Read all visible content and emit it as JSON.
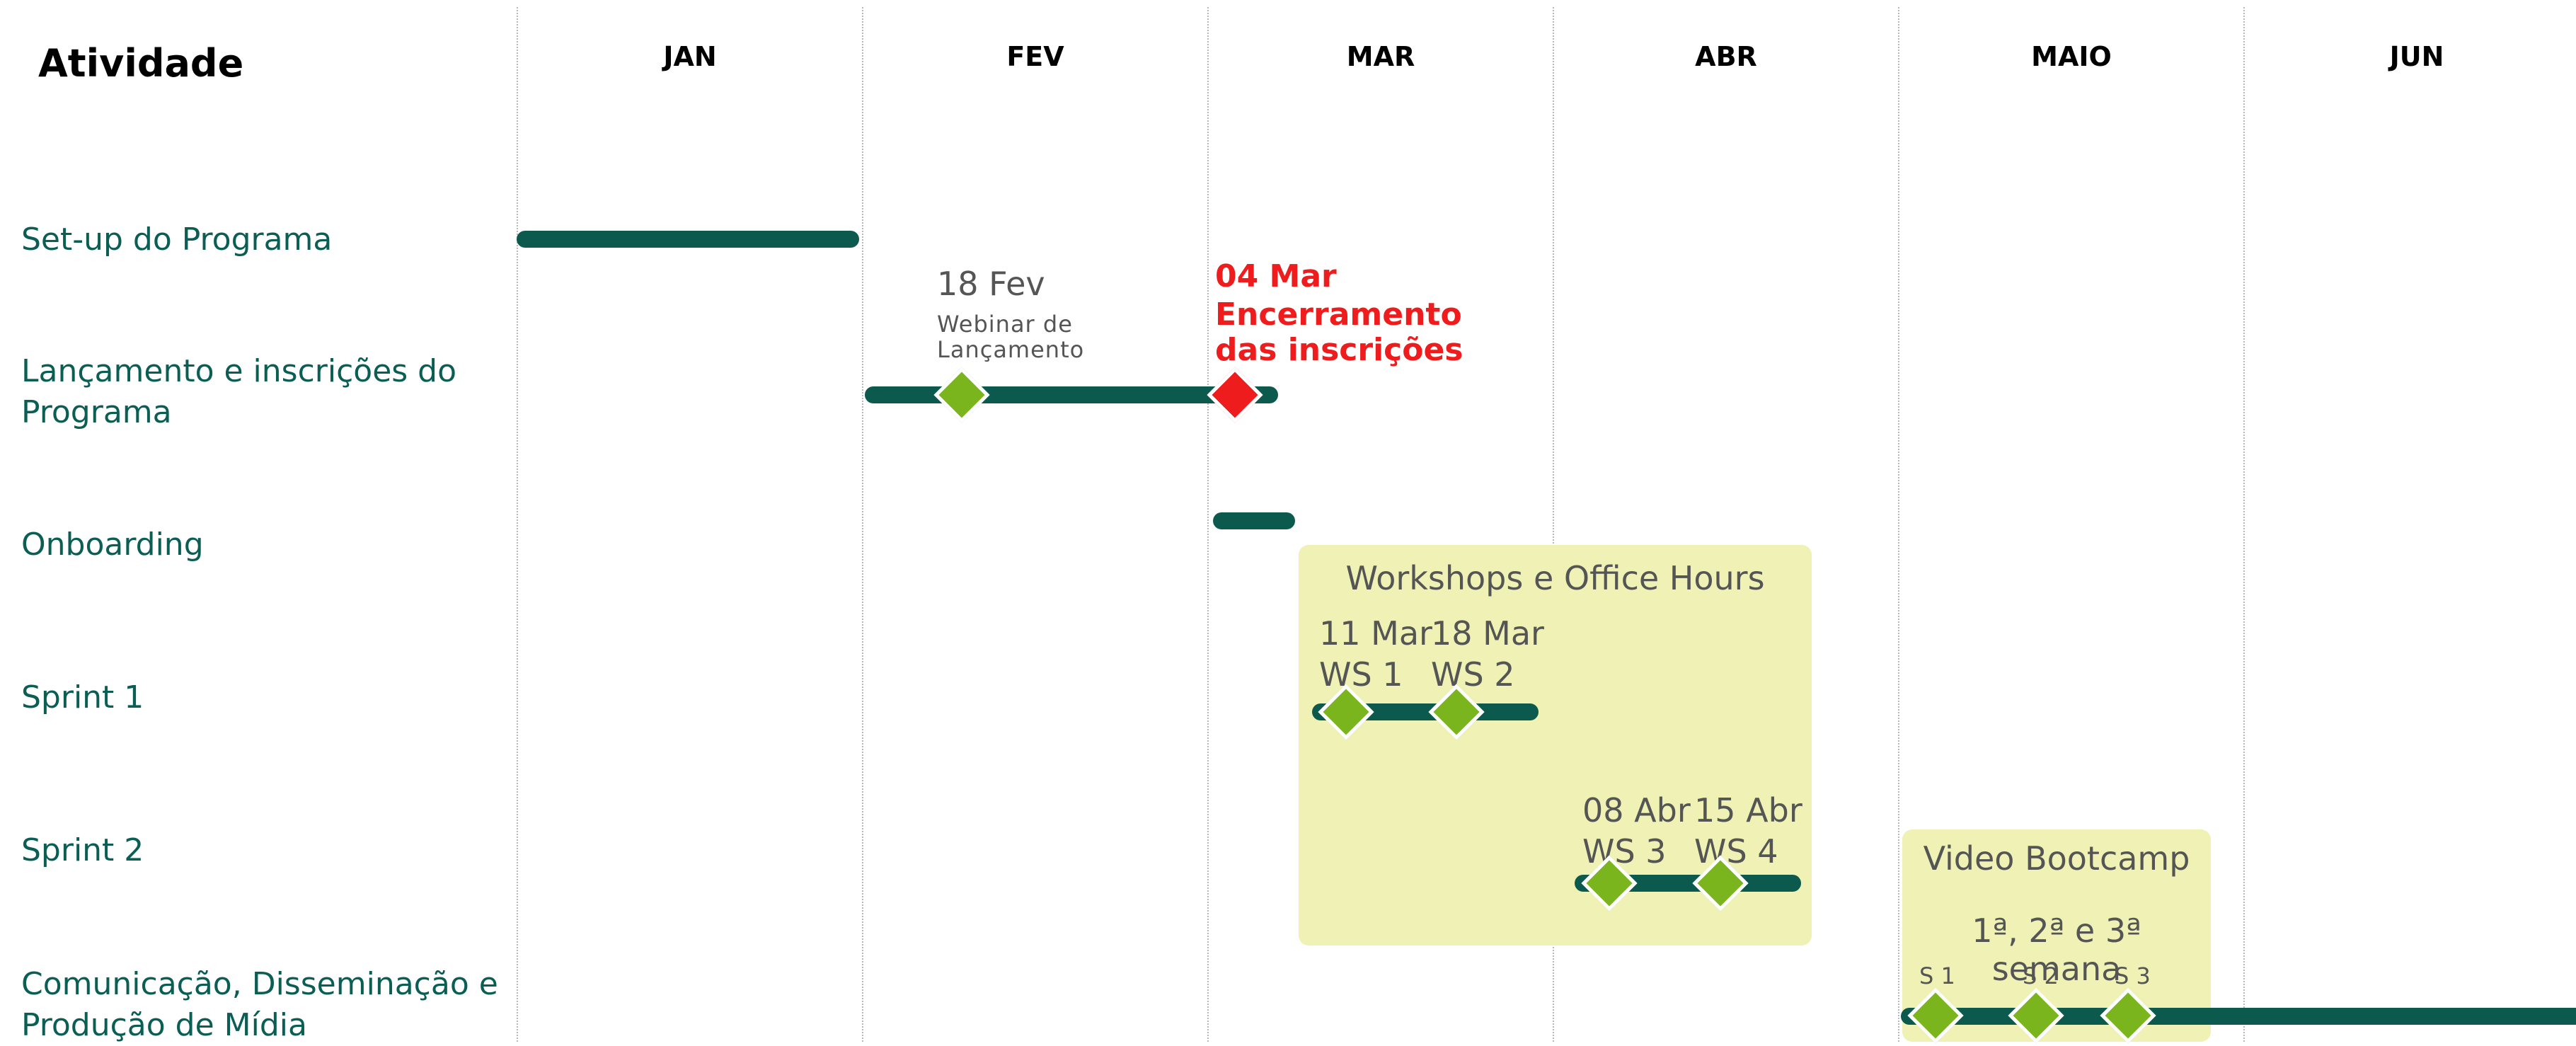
{
  "header": {
    "activity_label": "Atividade"
  },
  "months": [
    "JAN",
    "FEV",
    "MAR",
    "ABR",
    "MAIO",
    "JUN"
  ],
  "rows": [
    {
      "label_lines": [
        "Set-up do Programa"
      ]
    },
    {
      "label_lines": [
        "Lançamento e inscrições do",
        "Programa"
      ]
    },
    {
      "label_lines": [
        "Onboarding"
      ]
    },
    {
      "label_lines": [
        "Sprint 1"
      ]
    },
    {
      "label_lines": [
        "Sprint 2"
      ]
    },
    {
      "label_lines": [
        "Comunicação, Disseminação e",
        "Produção de Mídia"
      ]
    }
  ],
  "milestones": {
    "webinar": {
      "date": "18 Fev",
      "desc_line1": "Webinar de",
      "desc_line2": "Lançamento"
    },
    "closing": {
      "date": "04 Mar",
      "desc_line1": "Encerramento",
      "desc_line2": "das inscrições"
    },
    "ws1": {
      "date": "11 Mar",
      "label": "WS 1"
    },
    "ws2": {
      "date": "18 Mar",
      "label": "WS 2"
    },
    "ws3": {
      "date": "08 Abr",
      "label": "WS 3"
    },
    "ws4": {
      "date": "15 Abr",
      "label": "WS 4"
    },
    "s1": {
      "label": "S 1"
    },
    "s2": {
      "label": "S 2"
    },
    "s3": {
      "label": "S 3"
    }
  },
  "boxes": {
    "workshops": {
      "title": "Workshops e Office Hours"
    },
    "bootcamp": {
      "title": "Video Bootcamp",
      "subtitle": "1ª, 2ª e 3ª semana"
    }
  },
  "colors": {
    "bar": "#0b5a4d",
    "milestone_green": "#7ab51d",
    "milestone_red": "#ee1c1c",
    "highlight_box": "#eff2b4",
    "row_label": "#0b5e54"
  }
}
